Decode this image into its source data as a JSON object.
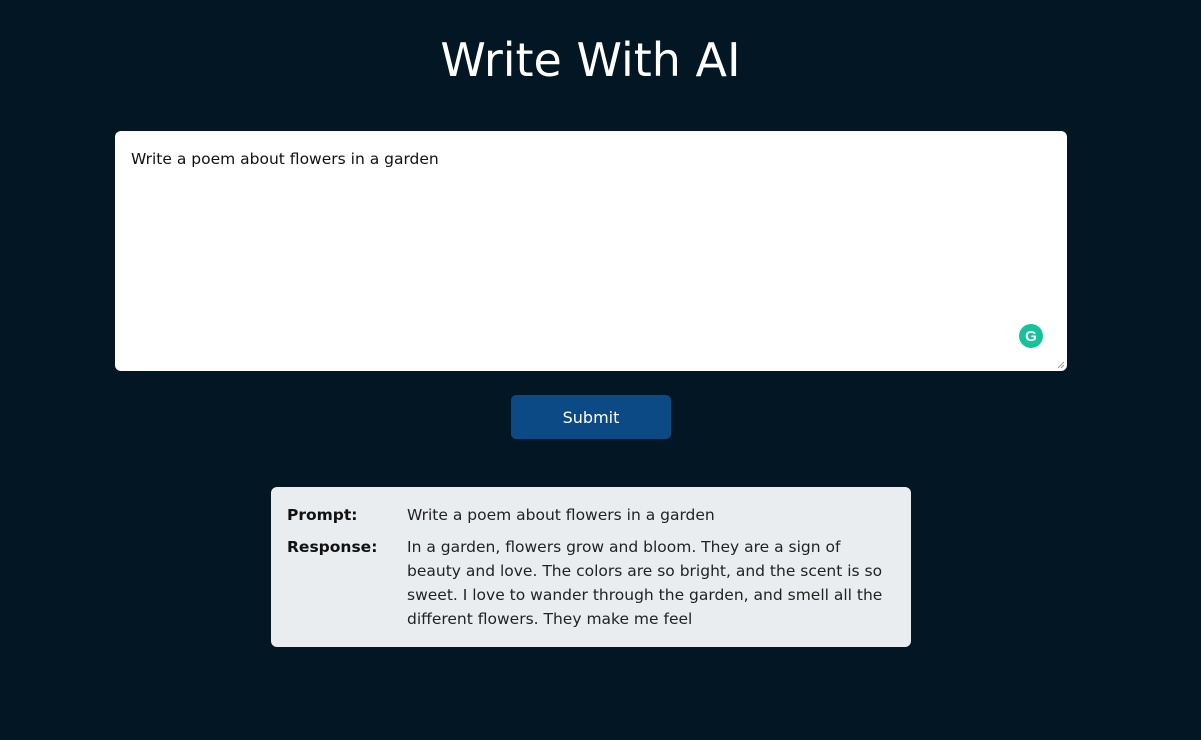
{
  "page": {
    "title": "Write With AI"
  },
  "prompt_input": {
    "value": "Write a poem about flowers in a garden",
    "grammarly_icon": "grammarly-icon"
  },
  "submit": {
    "label": "Submit"
  },
  "result": {
    "prompt_label": "Prompt:",
    "prompt_value": "Write a poem about flowers in a garden",
    "response_label": "Response:",
    "response_value": "In a garden, flowers grow and bloom. They are a sign of beauty and love. The colors are so bright, and the scent is so sweet. I love to wander through the garden, and smell all the different flowers. They make me feel"
  },
  "colors": {
    "background": "#021623",
    "button": "#0c4a85",
    "card": "#eaedf0",
    "grammarly": "#15c39a"
  }
}
